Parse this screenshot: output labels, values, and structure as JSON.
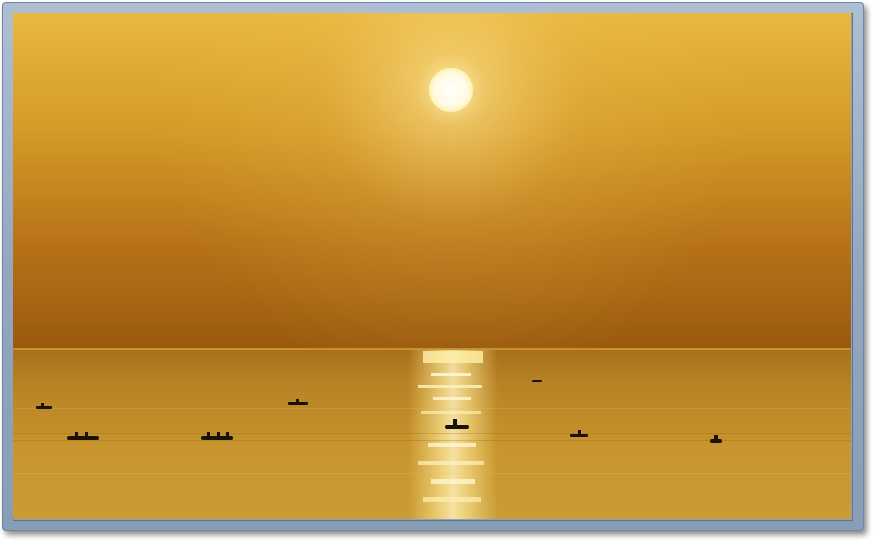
{
  "scene": {
    "subject": "sunset-over-sea",
    "elements": [
      "sun",
      "sky",
      "sea",
      "sun-reflection",
      "fishing-boats"
    ],
    "colors": {
      "sky_top": "#e8b640",
      "sky_mid": "#c98a1e",
      "sky_horizon": "#9c5c0e",
      "sun": "#fffbe6",
      "sea_near_horizon": "#b07a18",
      "sea": "#c89a2e",
      "reflection": "#ffe58a",
      "boat": "#1a1206",
      "frame": "#9fb2c8"
    },
    "boat_count": 9
  }
}
